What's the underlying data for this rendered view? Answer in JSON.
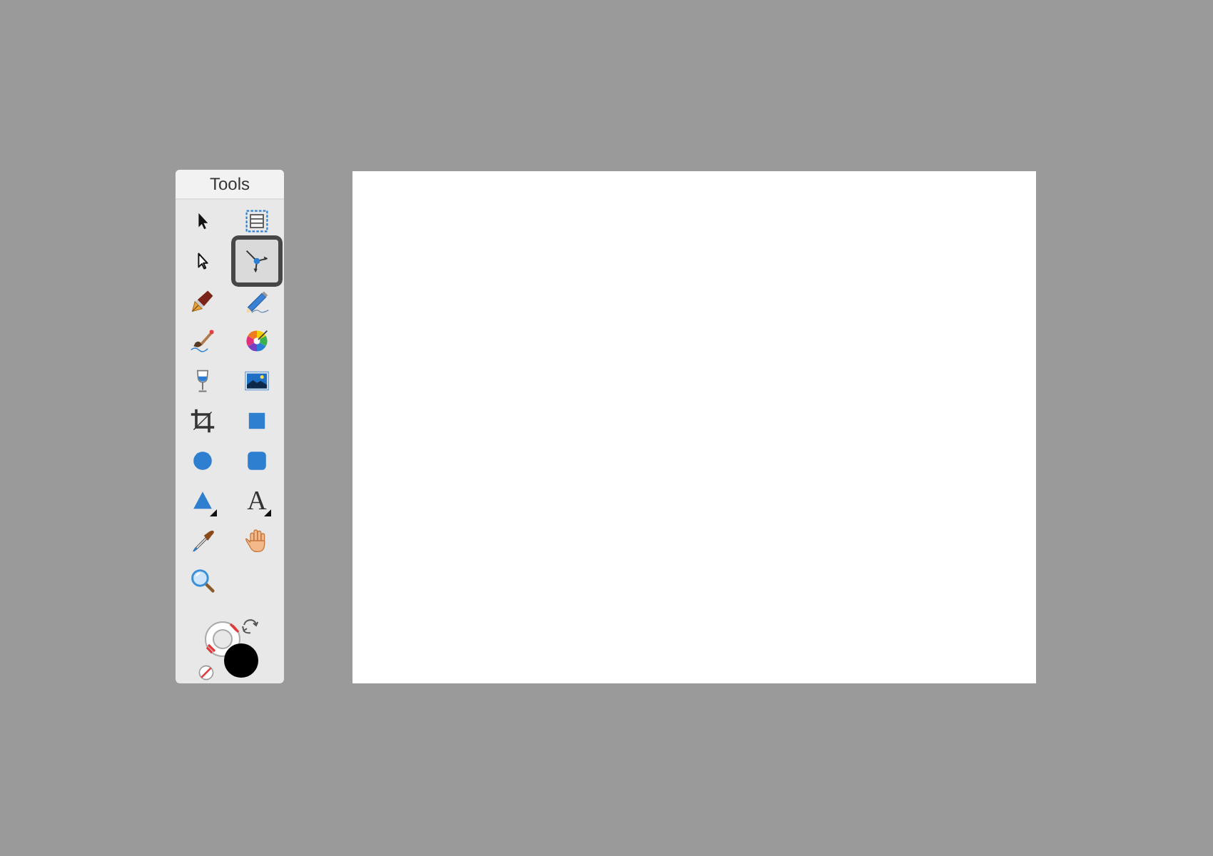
{
  "palette": {
    "title": "Tools",
    "tools": [
      {
        "kind": "pointer",
        "selected": false,
        "submenu": false
      },
      {
        "kind": "frame",
        "selected": false,
        "submenu": false
      },
      {
        "kind": "direct-pointer",
        "selected": false,
        "submenu": false
      },
      {
        "kind": "node",
        "selected": true,
        "submenu": false
      },
      {
        "kind": "pen",
        "selected": false,
        "submenu": false
      },
      {
        "kind": "pencil",
        "selected": false,
        "submenu": false
      },
      {
        "kind": "brush",
        "selected": false,
        "submenu": false
      },
      {
        "kind": "color-wheel",
        "selected": false,
        "submenu": false
      },
      {
        "kind": "glass",
        "selected": false,
        "submenu": false
      },
      {
        "kind": "image",
        "selected": false,
        "submenu": false
      },
      {
        "kind": "crop",
        "selected": false,
        "submenu": false
      },
      {
        "kind": "rectangle",
        "selected": false,
        "submenu": false
      },
      {
        "kind": "ellipse",
        "selected": false,
        "submenu": false
      },
      {
        "kind": "rounded-rectangle",
        "selected": false,
        "submenu": false
      },
      {
        "kind": "triangle",
        "selected": false,
        "submenu": true
      },
      {
        "kind": "text",
        "glyph": "A",
        "selected": false,
        "submenu": true
      },
      {
        "kind": "eyedropper",
        "selected": false,
        "submenu": false
      },
      {
        "kind": "hand",
        "selected": false,
        "submenu": false
      },
      {
        "kind": "zoom",
        "selected": false,
        "submenu": false
      }
    ],
    "color_wells": [
      {
        "kind": "fill",
        "color": "#ffffff"
      },
      {
        "kind": "stroke",
        "color": "#000000"
      }
    ]
  }
}
